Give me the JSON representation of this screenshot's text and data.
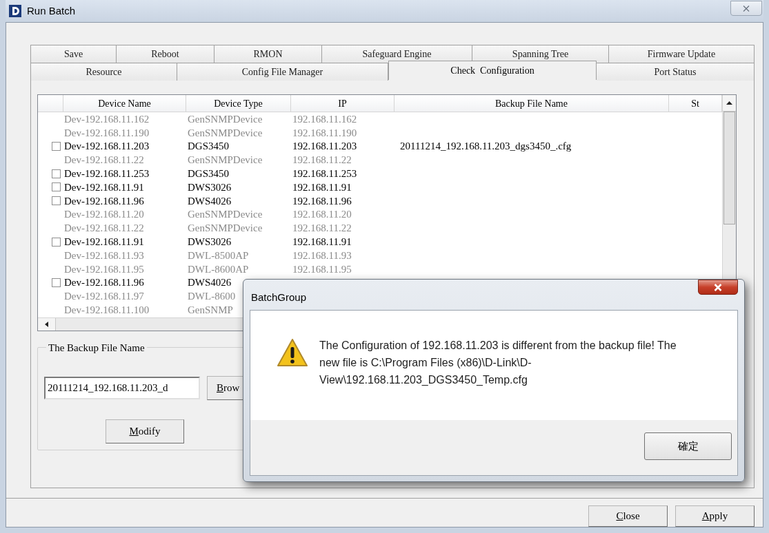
{
  "window": {
    "title": "Run Batch"
  },
  "tab_rows": [
    {
      "tabs": [
        {
          "label": "Save",
          "selected": false
        },
        {
          "label": "Reboot",
          "selected": false
        },
        {
          "label": "RMON",
          "selected": false
        },
        {
          "label": "Safeguard Engine",
          "selected": false
        },
        {
          "label": "Spanning Tree",
          "selected": false
        },
        {
          "label": "Firmware Update",
          "selected": false
        }
      ]
    },
    {
      "tabs": [
        {
          "label": "Resource",
          "selected": false
        },
        {
          "label": "Config File Manager",
          "selected": false
        },
        {
          "label": "Check  Configuration",
          "selected": true
        },
        {
          "label": "Port Status",
          "selected": false
        }
      ]
    }
  ],
  "device_table": {
    "columns": [
      "Device Name",
      "Device Type",
      "IP",
      "Backup File Name",
      "St"
    ],
    "rows": [
      {
        "device_name": "Dev-192.168.11.162",
        "device_type": "GenSNMPDevice",
        "ip": "192.168.11.162",
        "disabled": true
      },
      {
        "device_name": "Dev-192.168.11.190",
        "device_type": "GenSNMPDevice",
        "ip": "192.168.11.190",
        "disabled": true
      },
      {
        "device_name": "Dev-192.168.11.203",
        "device_type": "DGS3450",
        "ip": "192.168.11.203",
        "backup_file_name": "20111214_192.168.11.203_dgs3450_.cfg",
        "disabled": false,
        "checked": false
      },
      {
        "device_name": "Dev-192.168.11.22",
        "device_type": "GenSNMPDevice",
        "ip": "192.168.11.22",
        "disabled": true
      },
      {
        "device_name": "Dev-192.168.11.253",
        "device_type": "DGS3450",
        "ip": "192.168.11.253",
        "disabled": false,
        "checked": false
      },
      {
        "device_name": "Dev-192.168.11.91",
        "device_type": "DWS3026",
        "ip": "192.168.11.91",
        "disabled": false,
        "checked": false
      },
      {
        "device_name": "Dev-192.168.11.96",
        "device_type": "DWS4026",
        "ip": "192.168.11.96",
        "disabled": false,
        "checked": false
      },
      {
        "device_name": "Dev-192.168.11.20",
        "device_type": "GenSNMPDevice",
        "ip": "192.168.11.20",
        "disabled": true
      },
      {
        "device_name": "Dev-192.168.11.22",
        "device_type": "GenSNMPDevice",
        "ip": "192.168.11.22",
        "disabled": true
      },
      {
        "device_name": "Dev-192.168.11.91",
        "device_type": "DWS3026",
        "ip": "192.168.11.91",
        "disabled": false,
        "checked": false
      },
      {
        "device_name": "Dev-192.168.11.93",
        "device_type": "DWL-8500AP",
        "ip": "192.168.11.93",
        "disabled": true
      },
      {
        "device_name": "Dev-192.168.11.95",
        "device_type": "DWL-8600AP",
        "ip": "192.168.11.95",
        "disabled": true
      },
      {
        "device_name": "Dev-192.168.11.96",
        "device_type": "DWS4026",
        "disabled": false,
        "checked": false
      },
      {
        "device_name": "Dev-192.168.11.97",
        "device_type": "DWL-8600",
        "disabled": true
      },
      {
        "device_name": "Dev-192.168.11.100",
        "device_type": "GenSNMP",
        "disabled": true
      }
    ]
  },
  "backup_group": {
    "title": "The Backup File Name",
    "file_name": "20111214_192.168.11.203_d",
    "browse_button": "Brow",
    "modify_button": "Modify"
  },
  "buttons": [
    "Close",
    "Apply"
  ],
  "dialog": {
    "title": "BatchGroup",
    "message": "The Configuration of 192.168.11.203 is different from the backup file! The new file is C:\\Program Files (x86)\\D-Link\\D-View\\192.168.11.203_DGS3450_Temp.cfg",
    "button": "確定"
  }
}
